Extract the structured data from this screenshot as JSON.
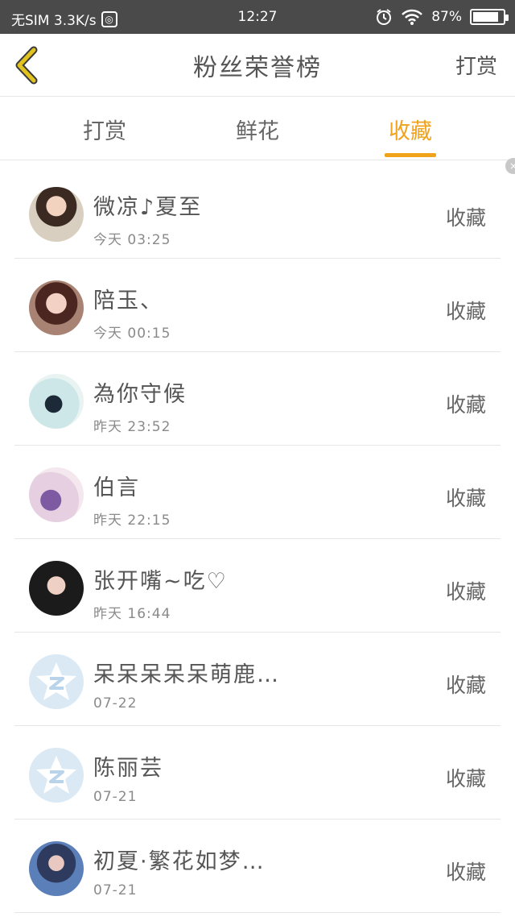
{
  "status_bar": {
    "carrier": "无SIM 3.3K/s",
    "time": "12:27",
    "battery": "87%",
    "battery_level": 0.87
  },
  "nav": {
    "title": "粉丝荣誉榜",
    "action_label": "打赏"
  },
  "tabs": [
    {
      "label": "打赏",
      "active": false
    },
    {
      "label": "鲜花",
      "active": false
    },
    {
      "label": "收藏",
      "active": true
    }
  ],
  "list_action_label": "收藏",
  "fans": [
    {
      "name": "微凉♪夏至",
      "time": "今天 03:25",
      "avatar": "photo"
    },
    {
      "name": "陪玉、",
      "time": "今天 00:15",
      "avatar": "photo"
    },
    {
      "name": "為你守候",
      "time": "昨天 23:52",
      "avatar": "photo"
    },
    {
      "name": "伯言",
      "time": "昨天 22:15",
      "avatar": "photo"
    },
    {
      "name": "张开嘴~吃♡",
      "time": "昨天 16:44",
      "avatar": "photo"
    },
    {
      "name": "呆呆呆呆呆萌鹿…",
      "time": "07-22",
      "avatar": "default"
    },
    {
      "name": "陈丽芸",
      "time": "07-21",
      "avatar": "default"
    },
    {
      "name": "初夏·繁花如梦…",
      "time": "07-21",
      "avatar": "photo"
    }
  ],
  "colors": {
    "accent": "#f0a21b",
    "status_bar": "#4a4a4a",
    "back_arrow": "#e2c21f",
    "default_avatar": "#dbe9f5"
  },
  "icons": {
    "back": "chevron-left-icon",
    "globe": "globe-icon",
    "alarm": "alarm-icon",
    "wifi": "wifi-icon",
    "battery": "battery-icon",
    "default_avatar": "qq-zone-star-icon"
  }
}
